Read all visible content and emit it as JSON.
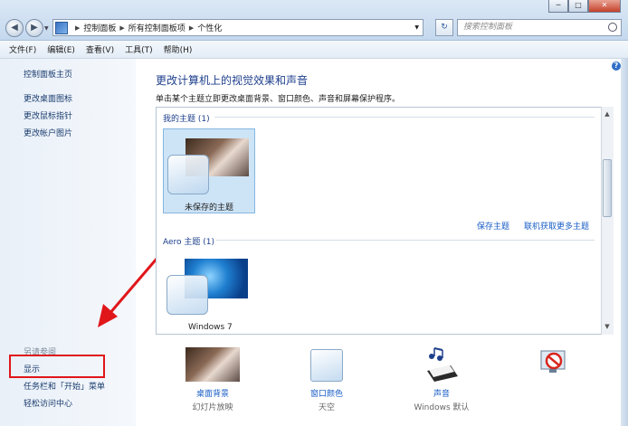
{
  "address": {
    "crumbs": [
      "控制面板",
      "所有控制面板项",
      "个性化"
    ],
    "search_placeholder": "搜索控制面板"
  },
  "window_buttons": {
    "minimize": "─",
    "maximize": "□",
    "close": "✕"
  },
  "menu": [
    "文件(F)",
    "编辑(E)",
    "查看(V)",
    "工具(T)",
    "帮助(H)"
  ],
  "sidebar": {
    "links": [
      "控制面板主页",
      "更改桌面图标",
      "更改鼠标指针",
      "更改帐户图片"
    ],
    "see_also_title": "另请参阅",
    "see_also": [
      "显示",
      "任务栏和「开始」菜单",
      "轻松访问中心"
    ]
  },
  "main": {
    "title": "更改计算机上的视觉效果和声音",
    "subtitle": "单击某个主题立即更改桌面背景、窗口颜色、声音和屏幕保护程序。",
    "my_themes_label": "我的主题 (1)",
    "unsaved_theme": "未保存的主题",
    "save_theme": "保存主题",
    "get_more_themes": "联机获取更多主题",
    "aero_label": "Aero 主题 (1)",
    "windows7_theme": "Windows 7"
  },
  "bottom": [
    {
      "label": "桌面背景",
      "sub": "幻灯片放映"
    },
    {
      "label": "窗口颜色",
      "sub": "天空"
    },
    {
      "label": "声音",
      "sub": "Windows 默认"
    },
    {
      "label": "",
      "sub": ""
    }
  ],
  "colors": {
    "link": "#1a5ec6",
    "title": "#1e3f8c",
    "highlight": "#e0161a"
  }
}
